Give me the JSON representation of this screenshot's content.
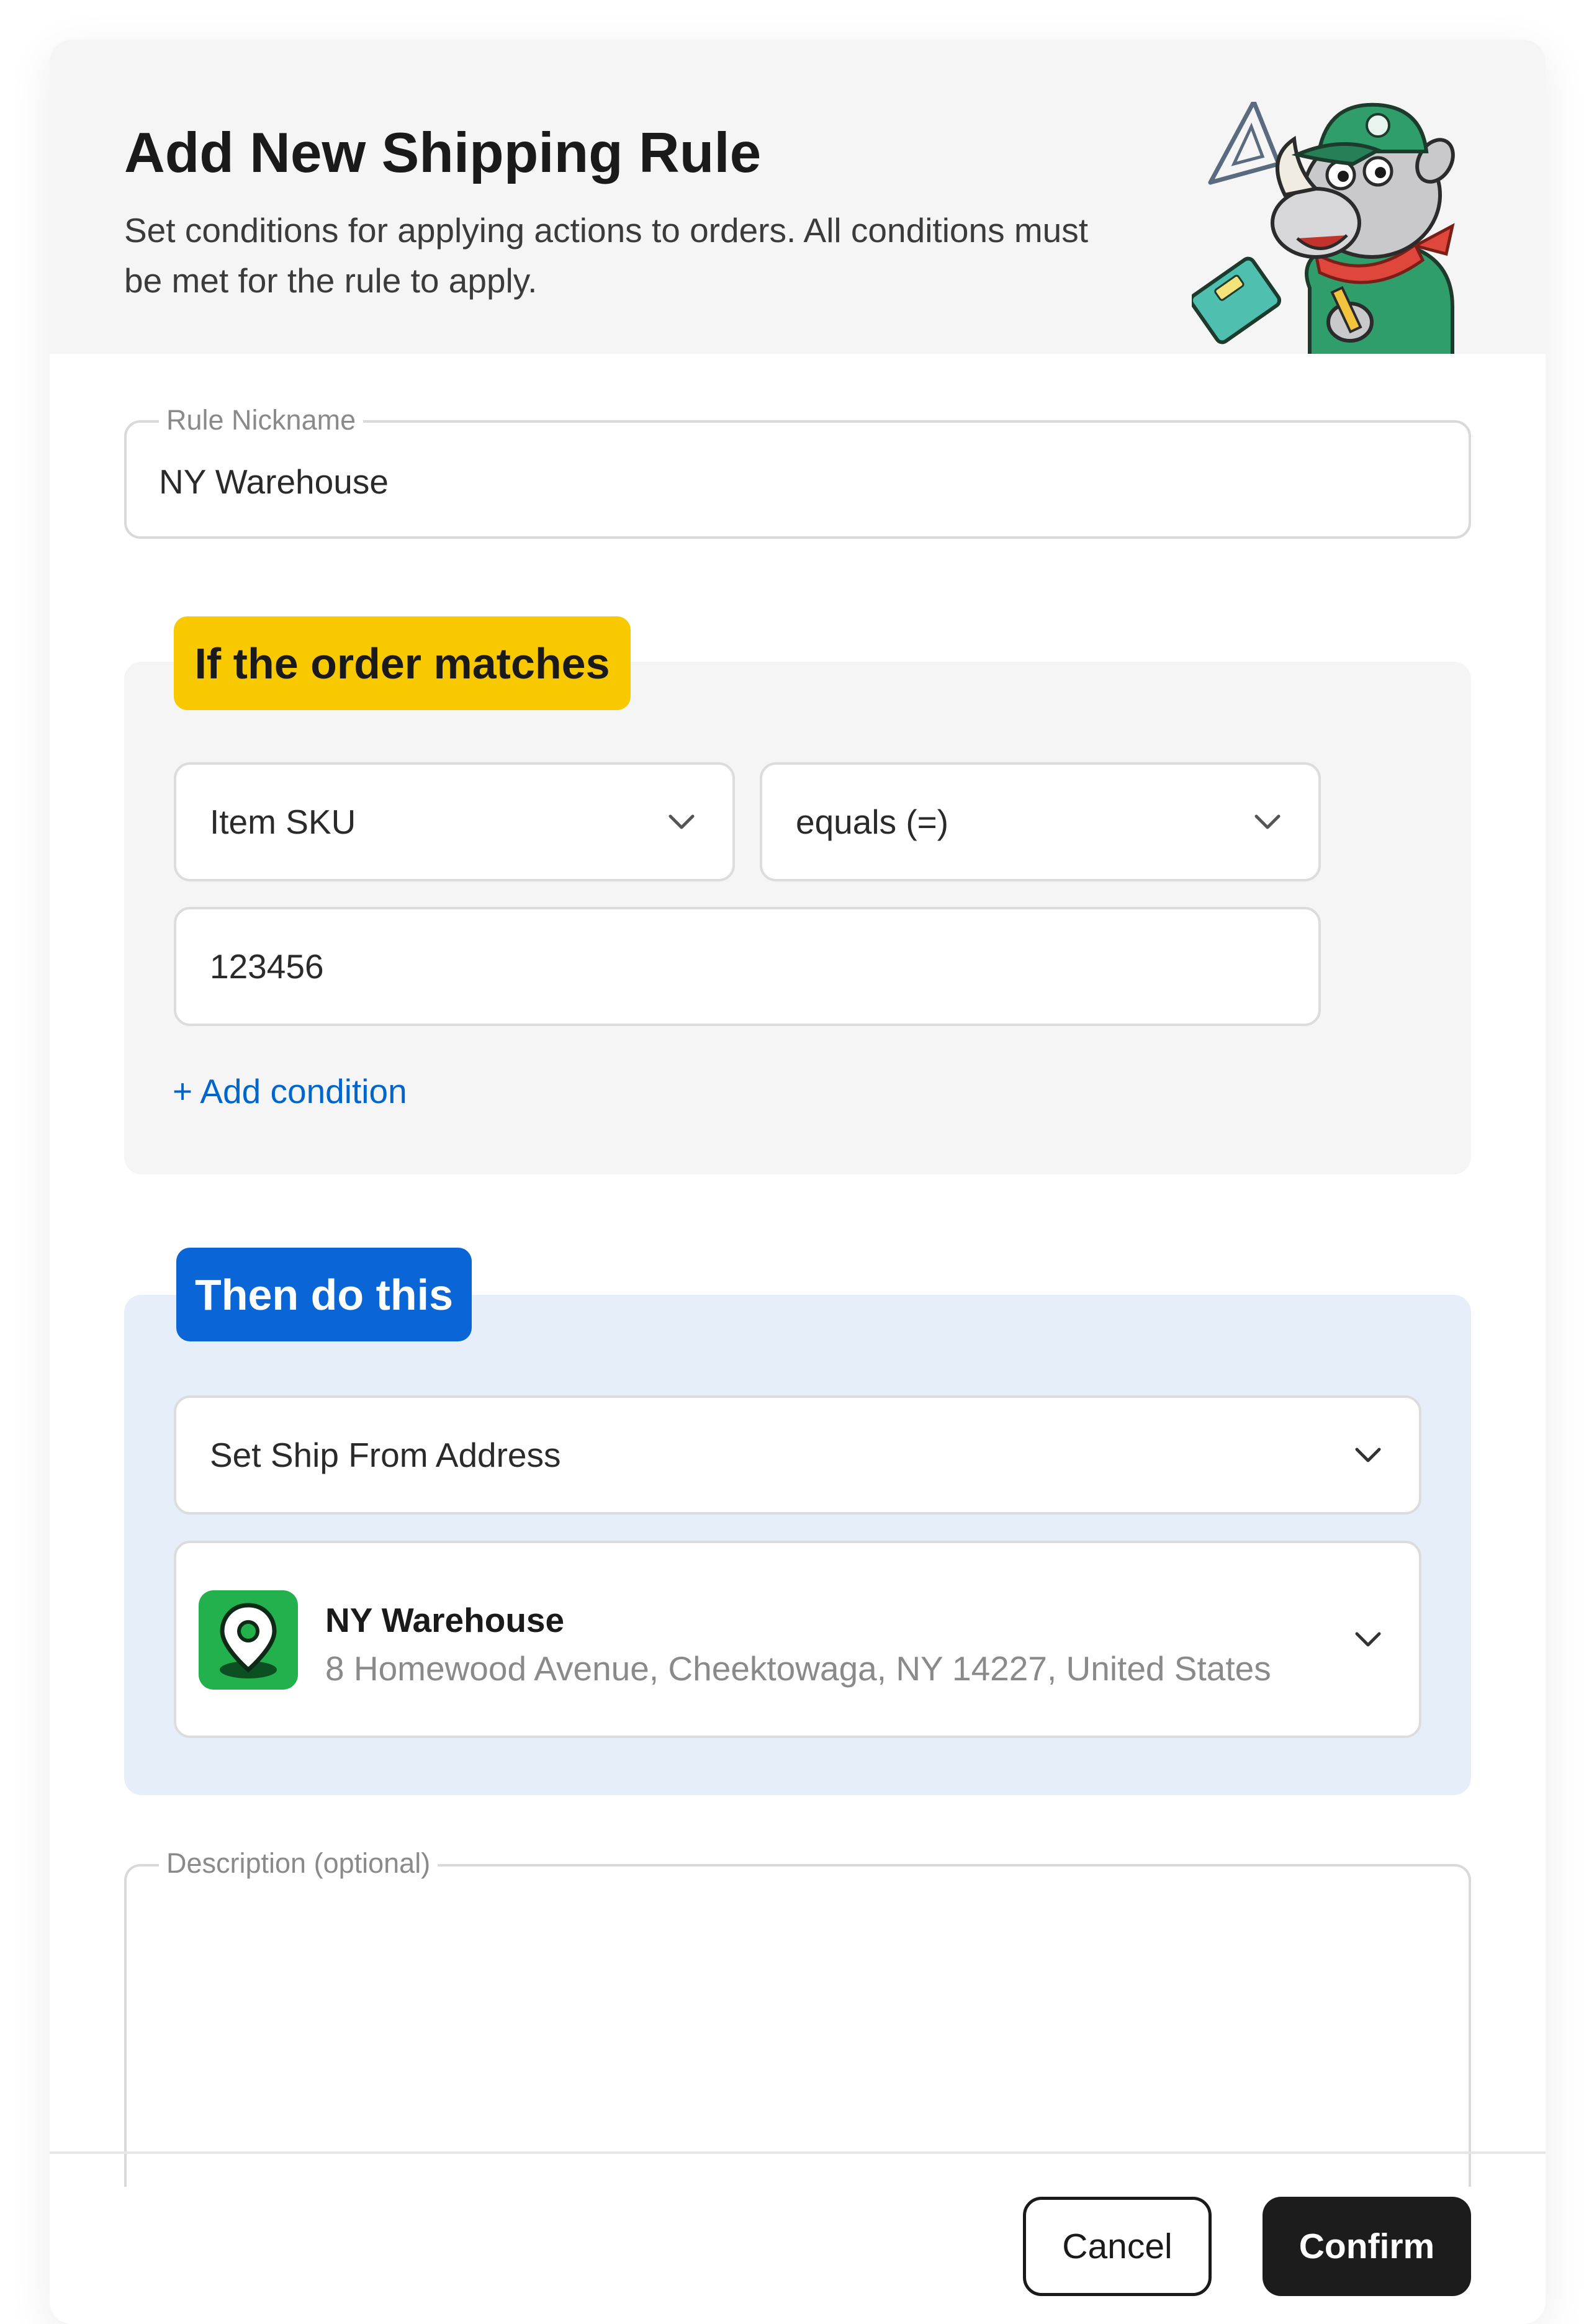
{
  "dialog": {
    "title": "Add New Shipping Rule",
    "subtitle": "Set conditions for applying actions to orders. All conditions must be met for the rule to apply."
  },
  "nickname": {
    "label": "Rule Nickname",
    "value": "NY Warehouse"
  },
  "conditions": {
    "heading": "If the order matches",
    "heading_color": "#f9c900",
    "field_select": "Item SKU",
    "operator_select": "equals  (=)",
    "value": "123456",
    "add_label": "+ Add condition",
    "link_color": "#0066cc"
  },
  "actions": {
    "heading": "Then do this",
    "heading_color": "#0a66d6",
    "action_select": "Set Ship From Address",
    "warehouse": {
      "name": "NY Warehouse",
      "address": "8 Homewood Avenue, Cheektowaga, NY 14227, United States",
      "icon": "location-pin-icon",
      "icon_color": "#22b14c"
    }
  },
  "description": {
    "label": "Description (optional)",
    "value": ""
  },
  "footer": {
    "cancel_label": "Cancel",
    "confirm_label": "Confirm"
  }
}
